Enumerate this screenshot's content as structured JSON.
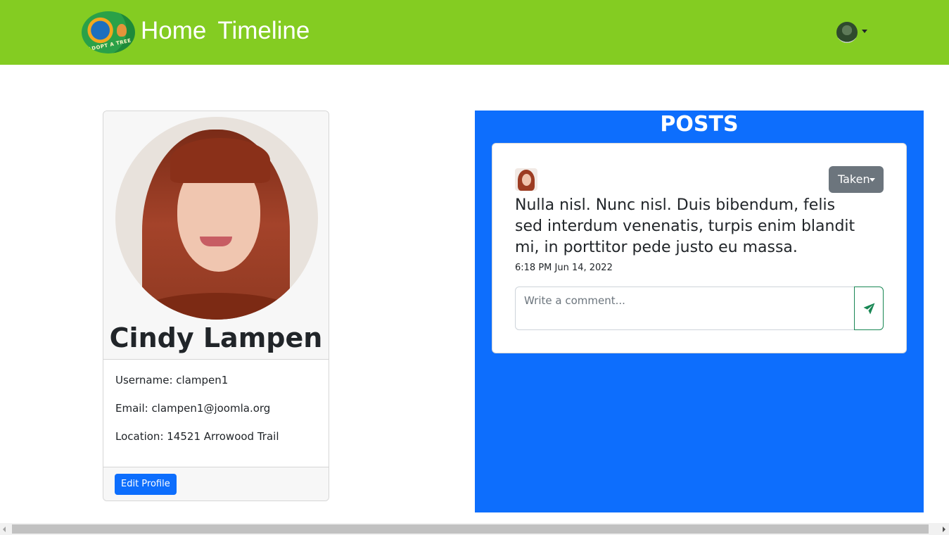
{
  "navbar": {
    "logo_text": "ADOPT A TREE",
    "brand_home": "Home",
    "brand_timeline": "Timeline",
    "bg_color": "#84cc22",
    "user_menu_icon": "user-avatar-icon",
    "caret_icon": "caret-down-icon"
  },
  "profile": {
    "name": "Cindy Lampen",
    "username": "Username: clampen1",
    "email": "Email: clampen1@joomla.org",
    "location": "Location: 14521 Arrowood Trail",
    "edit_label": "Edit Profile"
  },
  "posts": {
    "title": "POSTS",
    "panel_color": "#0d6efd",
    "items": [
      {
        "status_label": "Taken",
        "text": "Nulla nisl. Nunc nisl. Duis bibendum, felis sed interdum venenatis, turpis enim blandit mi, in porttitor pede justo eu massa.",
        "timestamp": "6:18 PM Jun 14, 2022",
        "comment_placeholder": "Write a comment...",
        "send_icon": "send-icon"
      }
    ]
  }
}
